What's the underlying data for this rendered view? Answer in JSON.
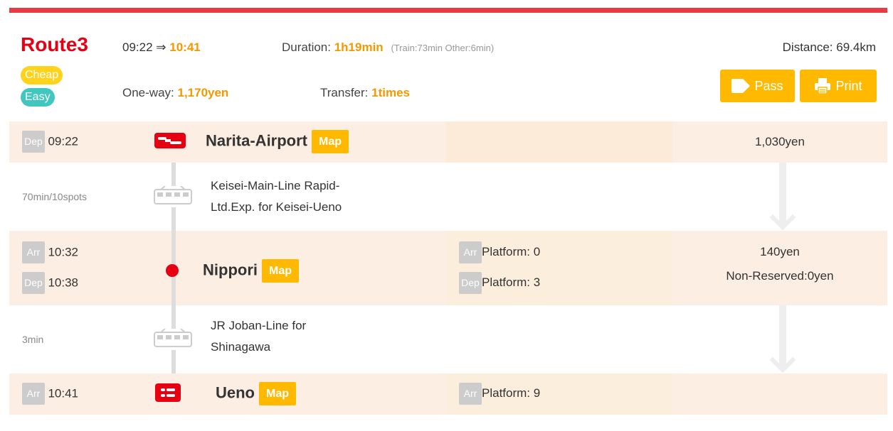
{
  "header": {
    "route_label": "Route3",
    "dep_time": "09:22",
    "arrow": "⇒",
    "arr_time": "10:41",
    "duration_label": "Duration:",
    "duration_value": "1h19min",
    "duration_detail": "(Train:73min Other:6min)",
    "distance": "Distance: 69.4km",
    "badges": [
      "Cheap",
      "Easy"
    ],
    "oneway_label": "One-way:",
    "oneway_value": "1,170yen",
    "transfer_label": "Transfer:",
    "transfer_value": "1times",
    "pass_label": "Pass",
    "print_label": "Print"
  },
  "rows": [
    {
      "type": "station",
      "tags": [
        {
          "tag": "Dep",
          "time": "09:22"
        }
      ],
      "station": "Narita-Airport",
      "map": "Map",
      "platforms": [],
      "fare": "1,030yen"
    },
    {
      "type": "move",
      "info": "70min/10spots",
      "line": [
        "Keisei-Main-Line Rapid-",
        "Ltd.Exp. for Keisei-Ueno"
      ]
    },
    {
      "type": "station",
      "tags": [
        {
          "tag": "Arr",
          "time": "10:32"
        },
        {
          "tag": "Dep",
          "time": "10:38"
        }
      ],
      "station": "Nippori",
      "map": "Map",
      "platforms": [
        {
          "tag": "Arr",
          "text": "Platform: 0"
        },
        {
          "tag": "Dep",
          "text": "Platform: 3"
        }
      ],
      "fare": "140yen",
      "fare_note": "Non-Reserved:0yen"
    },
    {
      "type": "move",
      "info": "3min",
      "line": [
        "JR Joban-Line for",
        "Shinagawa"
      ]
    },
    {
      "type": "station",
      "tags": [
        {
          "tag": "Arr",
          "time": "10:41"
        }
      ],
      "station": "Ueno",
      "map": "Map",
      "platforms": [
        {
          "tag": "Arr",
          "text": "Platform: 9"
        }
      ]
    }
  ],
  "colors": {
    "accent_red": "#e60012",
    "accent_orange": "#f39800",
    "button_yellow": "#ffb900",
    "easy_teal": "#42c7c0"
  }
}
